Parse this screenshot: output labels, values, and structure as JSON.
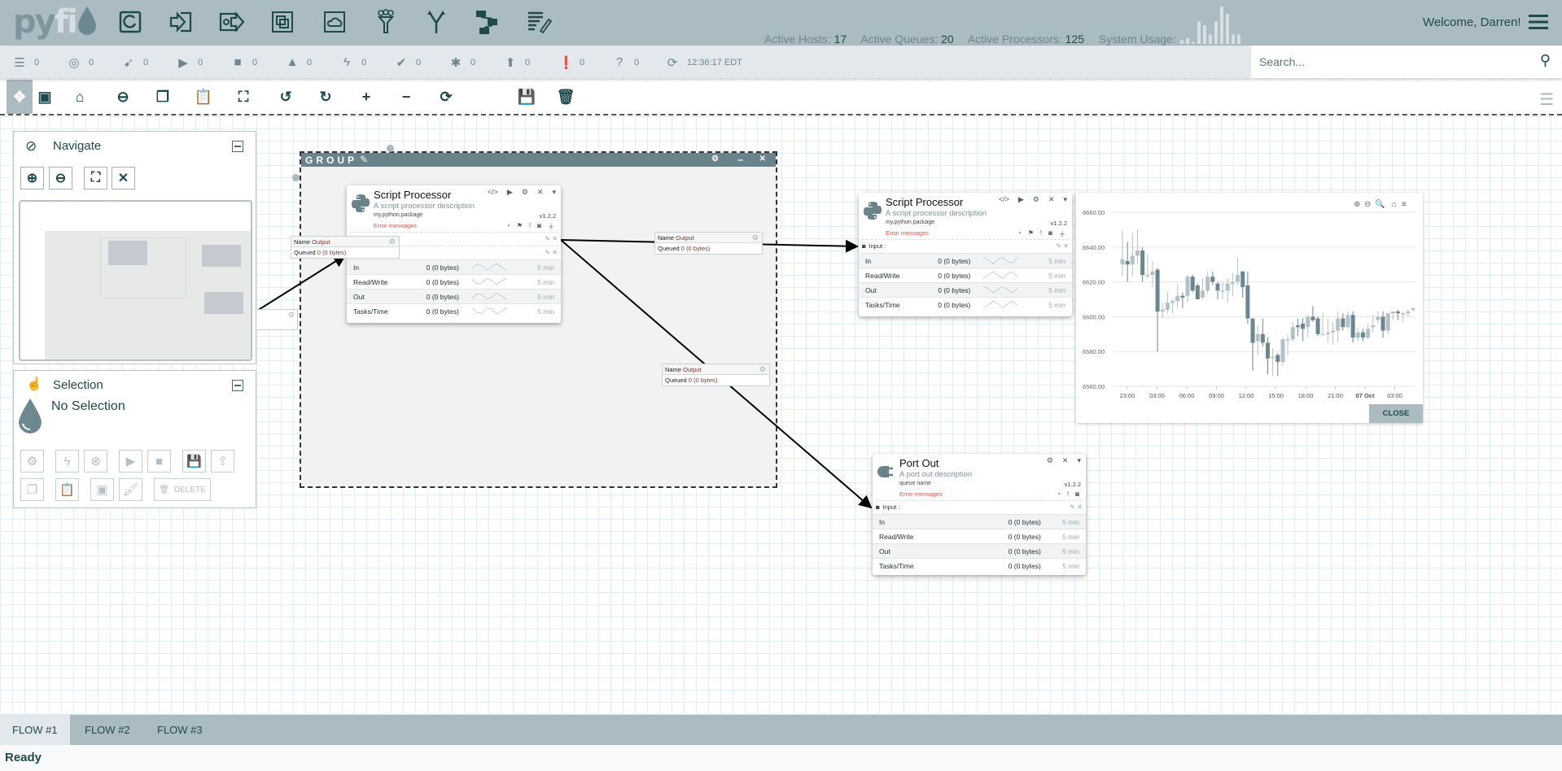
{
  "header": {
    "logo": "pyfi",
    "nav_icons": [
      "processor-icon",
      "port-in-icon",
      "port-out-icon",
      "group-icon",
      "remote-group-icon",
      "funnel-icon",
      "merge-icon",
      "flow-icon",
      "label-icon"
    ],
    "stats": {
      "hosts_label": "Active Hosts:",
      "hosts": "17",
      "queues_label": "Active Queues:",
      "queues": "20",
      "processors_label": "Active Processors:",
      "processors": "125",
      "usage_label": "System Usage:"
    },
    "system_usage_bars": [
      0.1,
      0.15,
      0.05,
      0.6,
      0.5,
      0.25,
      0.6,
      1.0,
      0.8,
      0.25,
      0.25
    ],
    "welcome": "Welcome, Darren!"
  },
  "statusbar": {
    "items": [
      {
        "icon": "list-icon",
        "count": "0"
      },
      {
        "icon": "target-icon",
        "count": "0"
      },
      {
        "icon": "broadcast-icon",
        "count": "0"
      },
      {
        "icon": "play-icon",
        "count": "0"
      },
      {
        "icon": "stop-icon",
        "count": "0"
      },
      {
        "icon": "warning-icon",
        "count": "0"
      },
      {
        "icon": "bolt-icon",
        "count": "0"
      },
      {
        "icon": "check-icon",
        "count": "0"
      },
      {
        "icon": "asterisk-icon",
        "count": "0"
      },
      {
        "icon": "upload-circle-icon",
        "count": "0"
      },
      {
        "icon": "exclamation-circle-icon",
        "count": "0"
      },
      {
        "icon": "question-icon",
        "count": "0"
      }
    ],
    "time": "12:36:17 EDT"
  },
  "search": {
    "placeholder": "Search..."
  },
  "toolbar": {
    "icons": [
      "move-icon",
      "select-group-icon",
      "home-icon",
      "minus-circle-icon",
      "copy-icon",
      "paste-icon",
      "fullscreen-icon",
      "undo-icon",
      "redo-icon",
      "plus-icon",
      "minus-icon",
      "refresh-icon",
      "code-icon",
      "save-icon",
      "trash-icon"
    ]
  },
  "navigate": {
    "title": "Navigate"
  },
  "selection": {
    "title": "Selection",
    "status": "No Selection",
    "delete_label": "DELETE"
  },
  "group": {
    "title": "GROUP"
  },
  "processor1": {
    "title": "Script Processor",
    "description": "A script processor description",
    "package": "my.python.package",
    "version": "v1.2.2",
    "error": "Error messages",
    "metrics": [
      {
        "label": "In",
        "value": "0 (0 bytes)",
        "window": "5 min"
      },
      {
        "label": "Read/Write",
        "value": "0 (0 bytes)",
        "window": "5 min"
      },
      {
        "label": "Out",
        "value": "0 (0 bytes)",
        "window": "5 min"
      },
      {
        "label": "Tasks/Time",
        "value": "0 (0 bytes)",
        "window": "5 min"
      }
    ]
  },
  "processor2": {
    "title": "Script Processor",
    "description": "A script processor description",
    "package": "my.python.package",
    "version": "v1.2.2",
    "error": "Error messages",
    "input_label": "Input :",
    "metrics": [
      {
        "label": "In",
        "value": "0 (0 bytes)",
        "window": "5 min"
      },
      {
        "label": "Read/Write",
        "value": "0 (0 bytes)",
        "window": "5 min"
      },
      {
        "label": "Out",
        "value": "0 (0 bytes)",
        "window": "5 min"
      },
      {
        "label": "Tasks/Time",
        "value": "0 (0 bytes)",
        "window": "5 min"
      }
    ]
  },
  "portout": {
    "title": "Port Out",
    "description": "A port out description",
    "package": "queue name",
    "version": "v1.2.2",
    "error": "Error messages",
    "input_label": "Input :",
    "metrics": [
      {
        "label": "In",
        "value": "0 (0 bytes)",
        "window": "5 min"
      },
      {
        "label": "Read/Write",
        "value": "0 (0 bytes)",
        "window": "5 min"
      },
      {
        "label": "Out",
        "value": "0 (0 bytes)",
        "window": "5 min"
      },
      {
        "label": "Tasks/Time",
        "value": "0 (0 bytes)",
        "window": "5 min"
      }
    ]
  },
  "connections": [
    {
      "name_label": "Name",
      "name": "Output",
      "queued_label": "Queued",
      "count": "0",
      "bytes": "(0 bytes)"
    },
    {
      "name_label": "Name",
      "name": "Output",
      "queued_label": "Queued",
      "count": "0",
      "bytes": "(0 bytes)"
    },
    {
      "name_label": "Name",
      "name": "Output",
      "queued_label": "Queued",
      "count": "0",
      "bytes": "(0 bytes)"
    }
  ],
  "chart_data": {
    "type": "candlestick",
    "title": "",
    "ylim": [
      6560,
      6660
    ],
    "y_ticks": [
      "6660.00",
      "6640.00",
      "6620.00",
      "6600.00",
      "6580.00",
      "6560.00"
    ],
    "x_ticks": [
      "23:00",
      "03:00",
      "06:00",
      "09:00",
      "12:00",
      "15:00",
      "18:00",
      "21:00",
      "07 Oct",
      "03:00"
    ],
    "grid": true,
    "colors": {
      "up": "#b3c1c7",
      "down": "#6b8690"
    },
    "ohlc": [
      [
        6630,
        6650,
        6623,
        6633
      ],
      [
        6632,
        6643,
        6620,
        6630
      ],
      [
        6630,
        6648,
        6623,
        6635
      ],
      [
        6635,
        6650,
        6630,
        6638
      ],
      [
        6638,
        6640,
        6620,
        6624
      ],
      [
        6624,
        6636,
        6622,
        6624
      ],
      [
        6624,
        6632,
        6617,
        6626
      ],
      [
        6627,
        6628,
        6580,
        6603
      ],
      [
        6603,
        6608,
        6599,
        6604
      ],
      [
        6604,
        6614,
        6602,
        6608
      ],
      [
        6608,
        6610,
        6602,
        6609
      ],
      [
        6609,
        6619,
        6605,
        6612
      ],
      [
        6612,
        6614,
        6605,
        6611
      ],
      [
        6612,
        6624,
        6608,
        6623
      ],
      [
        6623,
        6624,
        6614,
        6615
      ],
      [
        6618,
        6619,
        6610,
        6610
      ],
      [
        6611,
        6622,
        6610,
        6615
      ],
      [
        6615,
        6626,
        6613,
        6623
      ],
      [
        6623,
        6626,
        6618,
        6620
      ],
      [
        6619,
        6620,
        6610,
        6615
      ],
      [
        6615,
        6620,
        6610,
        6615
      ],
      [
        6615,
        6622,
        6608,
        6619
      ],
      [
        6619,
        6625,
        6612,
        6620
      ],
      [
        6620,
        6634,
        6618,
        6624
      ],
      [
        6626,
        6626,
        6611,
        6617
      ],
      [
        6618,
        6626,
        6596,
        6599
      ],
      [
        6599,
        6599,
        6569,
        6585
      ],
      [
        6586,
        6595,
        6578,
        6590
      ],
      [
        6590,
        6599,
        6583,
        6585
      ],
      [
        6585,
        6588,
        6567,
        6576
      ],
      [
        6577,
        6582,
        6566,
        6577
      ],
      [
        6578,
        6579,
        6566,
        6574
      ],
      [
        6574,
        6588,
        6572,
        6587
      ],
      [
        6587,
        6590,
        6578,
        6587
      ],
      [
        6587,
        6597,
        6586,
        6594
      ],
      [
        6595,
        6599,
        6589,
        6594
      ],
      [
        6596,
        6599,
        6586,
        6593
      ],
      [
        6594,
        6601,
        6588,
        6600
      ],
      [
        6600,
        6606,
        6597,
        6598
      ],
      [
        6599,
        6600,
        6589,
        6590
      ],
      [
        6590,
        6602,
        6590,
        6590
      ],
      [
        6590,
        6599,
        6585,
        6591
      ],
      [
        6591,
        6597,
        6584,
        6592
      ],
      [
        6592,
        6603,
        6585,
        6599
      ],
      [
        6599,
        6602,
        6592,
        6594
      ],
      [
        6594,
        6603,
        6593,
        6601
      ],
      [
        6601,
        6603,
        6585,
        6588
      ],
      [
        6588,
        6594,
        6586,
        6591
      ],
      [
        6591,
        6593,
        6586,
        6588
      ],
      [
        6588,
        6596,
        6587,
        6593
      ],
      [
        6594,
        6601,
        6591,
        6595
      ],
      [
        6598,
        6603,
        6596,
        6600
      ],
      [
        6600,
        6603,
        6588,
        6592
      ],
      [
        6592,
        6602,
        6590,
        6602
      ],
      [
        6602,
        6603,
        6598,
        6603
      ],
      [
        6603,
        6604,
        6598,
        6602
      ],
      [
        6602,
        6603,
        6597,
        6602
      ],
      [
        6602,
        6604,
        6600,
        6603
      ],
      [
        6604,
        6605,
        6603,
        6605
      ]
    ],
    "toolbar_icons": [
      "zoom-in-icon",
      "zoom-out-icon",
      "zoom-select-icon",
      "home-icon",
      "menu-icon"
    ],
    "close_label": "CLOSE"
  },
  "tabs": [
    {
      "label": "FLOW #1",
      "active": true
    },
    {
      "label": "FLOW #2"
    },
    {
      "label": "FLOW #3"
    }
  ],
  "status": "Ready"
}
